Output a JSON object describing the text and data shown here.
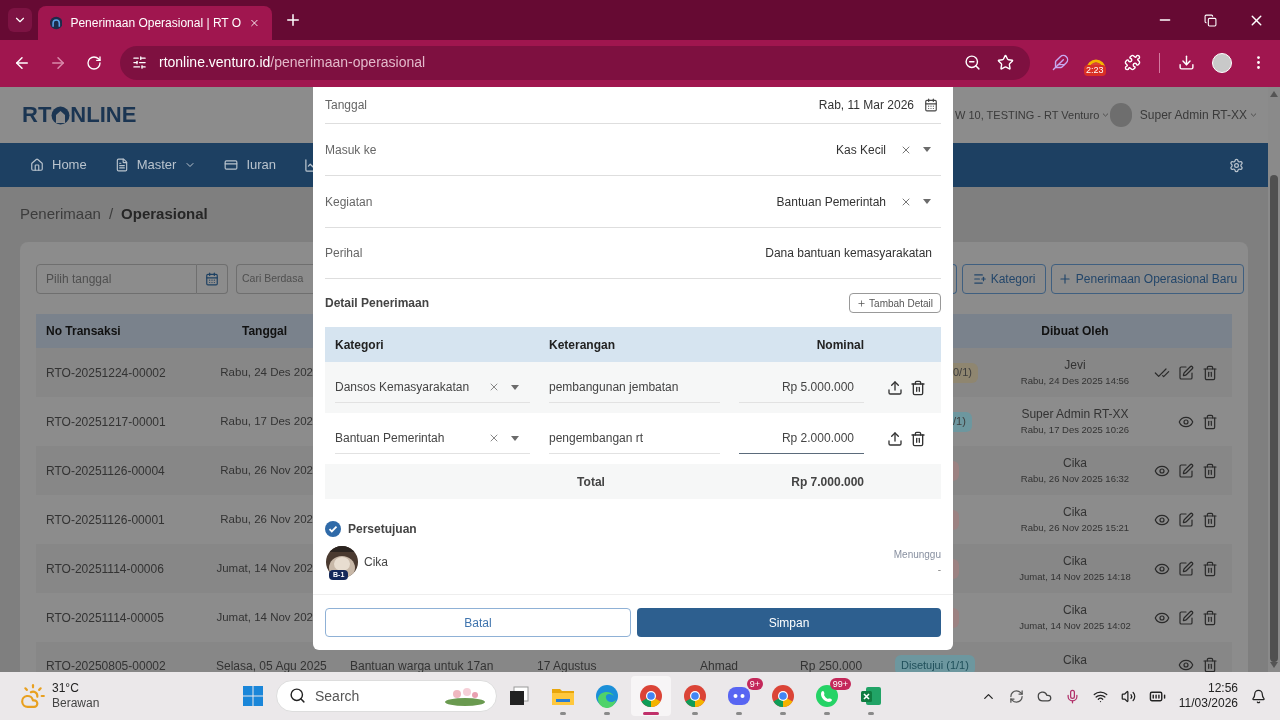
{
  "browser": {
    "tab_title": "Penerimaan Operasional | RT O",
    "url_domain": "rtonline.venturo.id",
    "url_path": "/penerimaan-operasional",
    "extension_badge": "2:23"
  },
  "header": {
    "logo_left": "RT",
    "logo_right": "NLINE",
    "location": "W 10, TESTING - RT Venturo",
    "user": "Super Admin RT-XX"
  },
  "nav": [
    {
      "label": "Home",
      "dropdown": false
    },
    {
      "label": "Master",
      "dropdown": true
    },
    {
      "label": "Iuran",
      "dropdown": false
    }
  ],
  "breadcrumb": {
    "parent": "Penerimaan",
    "separator": "/",
    "current": "Operasional"
  },
  "filters": {
    "date_placeholder": "Pilih tanggal",
    "search_placeholder": "Cari Berdasa",
    "buttons": [
      "Kategori",
      "Penerimaan Operasional Baru"
    ]
  },
  "table": {
    "columns": [
      "No Transaksi",
      "Tanggal",
      "Dibuat Oleh"
    ],
    "rows": [
      {
        "id": "RTO-20251224-00002",
        "date": "Rabu, 24 Des 202",
        "status": {
          "text": "0/1)",
          "color": "#8f8670"
        },
        "creator": "Jevi",
        "created": "Rabu, 24 Des 2025 14:56",
        "actions": [
          {
            "kind": "approve"
          },
          {
            "kind": "edit"
          },
          {
            "kind": "delete"
          }
        ]
      },
      {
        "id": "RTO-20251217-00001",
        "date": "Rabu, 17 Des 202",
        "status": {
          "text": "/1)",
          "color": "#6d979f"
        },
        "creator": "Super Admin RT-XX",
        "created": "Rabu, 17 Des 2025 10:26",
        "actions": [
          {
            "kind": "view"
          },
          {
            "kind": "delete"
          }
        ]
      },
      {
        "id": "RTO-20251126-00004",
        "date": "Rabu, 26 Nov 202",
        "status": {
          "color": "#9c8282"
        },
        "creator": "Cika",
        "created": "Rabu, 26 Nov 2025 16:32",
        "actions": [
          {
            "kind": "view"
          },
          {
            "kind": "edit"
          },
          {
            "kind": "delete"
          }
        ]
      },
      {
        "id": "RTO-20251126-00001",
        "date": "Rabu, 26 Nov 202",
        "status": {
          "color": "#9c8282"
        },
        "creator": "Cika",
        "created": "Rabu, 26 Nov 2025 15:21",
        "actions": [
          {
            "kind": "view"
          },
          {
            "kind": "edit"
          },
          {
            "kind": "delete"
          }
        ]
      },
      {
        "id": "RTO-20251114-00006",
        "date": "Jumat, 14 Nov 202",
        "status": {
          "color": "#9c8282"
        },
        "creator": "Cika",
        "created": "Jumat, 14 Nov 2025 14:18",
        "actions": [
          {
            "kind": "view"
          },
          {
            "kind": "edit"
          },
          {
            "kind": "delete"
          }
        ]
      },
      {
        "id": "RTO-20251114-00005",
        "date": "Jumat, 14 Nov 202",
        "status": {
          "color": "#9c8282"
        },
        "creator": "Cika",
        "created": "Jumat, 14 Nov 2025 14:02",
        "actions": [
          {
            "kind": "view"
          },
          {
            "kind": "edit"
          },
          {
            "kind": "delete"
          }
        ]
      }
    ],
    "last_row": {
      "id": "RTO-20250805-00002",
      "date": "Selasa, 05 Agu 2025",
      "description": "Bantuan warga untuk 17an",
      "activity": "17 Agustus",
      "payer": "Ahmad",
      "amount": "Rp 250.000",
      "status": {
        "text": "Disetujui (1/1)",
        "color": "#6d979f"
      },
      "creator": "Cika",
      "actions": [
        {
          "kind": "view"
        },
        {
          "kind": "delete"
        }
      ]
    }
  },
  "modal": {
    "fields": [
      {
        "label": "Tanggal",
        "value": "Rab, 11 Mar 2026",
        "kind": "date"
      },
      {
        "label": "Masuk ke",
        "value": "Kas Kecil",
        "kind": "select"
      },
      {
        "label": "Kegiatan",
        "value": "Bantuan Pemerintah",
        "kind": "select"
      },
      {
        "label": "Perihal",
        "value": "Dana bantuan kemasyarakatan",
        "kind": "text"
      }
    ],
    "detail": {
      "title": "Detail Penerimaan",
      "add_button": "Tambah Detail",
      "columns": [
        "Kategori",
        "Keterangan",
        "Nominal"
      ],
      "rows": [
        {
          "category": "Dansos Kemasyarakatan",
          "note": "pembangunan jembatan",
          "amount": "Rp 5.000.000",
          "focused": false
        },
        {
          "category": "Bantuan Pemerintah",
          "note": "pengembangan rt",
          "amount": "Rp 2.000.000",
          "focused": true
        }
      ],
      "total_label": "Total",
      "total": "Rp 7.000.000"
    },
    "approval": {
      "title": "Persetujuan",
      "approvers": [
        {
          "name": "Cika",
          "badge": "B-1",
          "status": "Menunggu",
          "date": "-"
        }
      ]
    },
    "cancel": "Batal",
    "save": "Simpan"
  },
  "taskbar": {
    "weather": {
      "temperature": "31°C",
      "condition": "Berawan"
    },
    "search_placeholder": "Search",
    "apps": [
      {
        "kind": "taskview",
        "open": false,
        "selected": false
      },
      {
        "kind": "files",
        "open": true,
        "selected": false
      },
      {
        "kind": "edge",
        "open": true,
        "selected": false
      },
      {
        "kind": "chrome",
        "open": true,
        "selected": true
      },
      {
        "kind": "chrome",
        "open": true,
        "selected": false
      },
      {
        "kind": "discord",
        "open": true,
        "selected": false,
        "badge": "9+"
      },
      {
        "kind": "chrome",
        "open": true,
        "selected": false
      },
      {
        "kind": "whatsapp",
        "open": true,
        "selected": false,
        "badge": "99+"
      },
      {
        "kind": "excel",
        "open": true,
        "selected": false
      }
    ],
    "time": "12:56",
    "date": "11/03/2026"
  }
}
